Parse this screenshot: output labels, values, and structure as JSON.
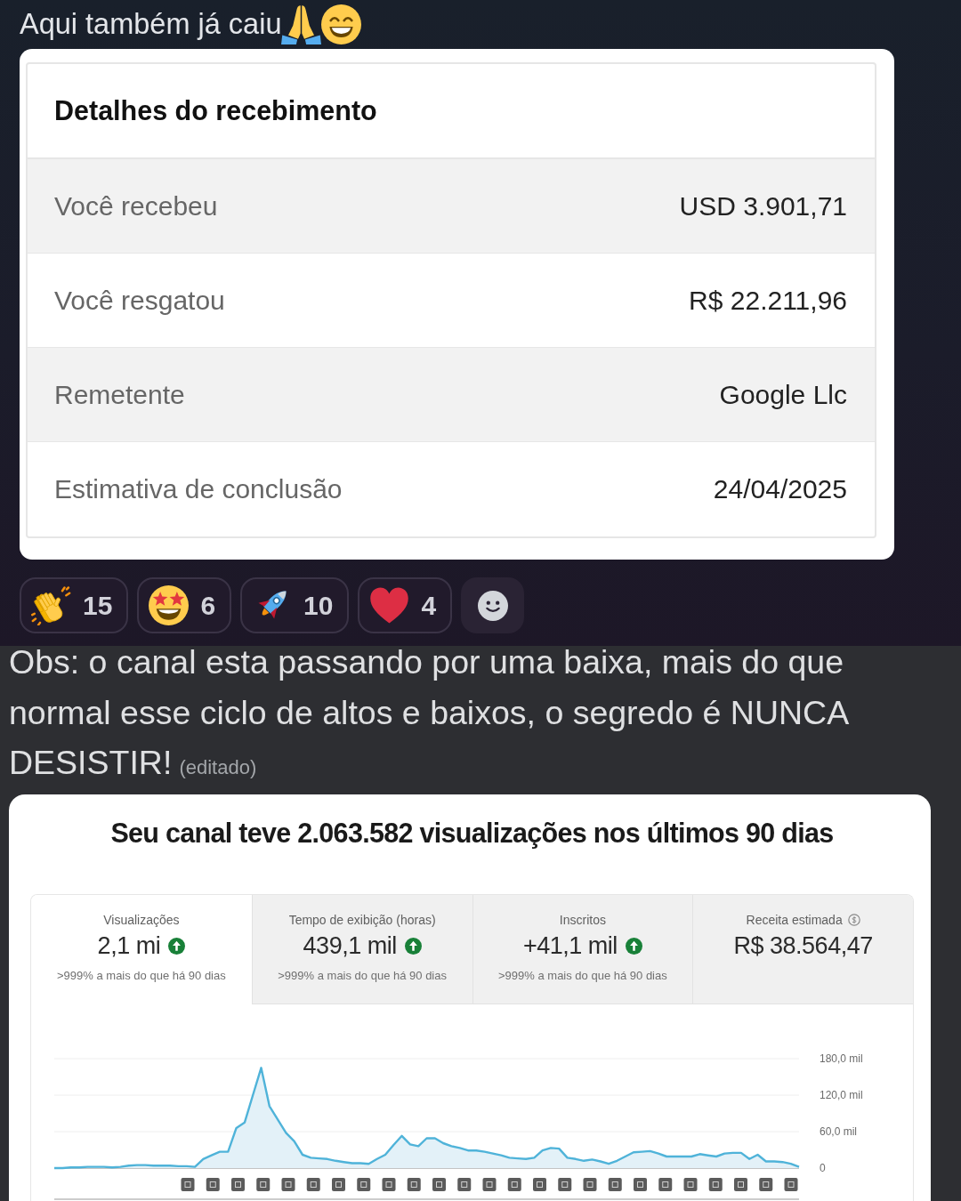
{
  "message": {
    "text": "Aqui também já caiu",
    "emojis": [
      {
        "kind": "praying-hands"
      },
      {
        "kind": "grinning-face"
      }
    ]
  },
  "receipt": {
    "title": "Detalhes do recebimento",
    "rows": [
      {
        "label": "Você recebeu",
        "value": "USD 3.901,71"
      },
      {
        "label": "Você resgatou",
        "value": "R$ 22.211,96"
      },
      {
        "label": "Remetente",
        "value": "Google Llc"
      },
      {
        "label": "Estimativa de conclusão",
        "value": "24/04/2025"
      }
    ]
  },
  "reactions": [
    {
      "kind": "clapping-hands",
      "count": "15"
    },
    {
      "kind": "star-struck",
      "count": "6"
    },
    {
      "kind": "rocket",
      "count": "10"
    },
    {
      "kind": "heart",
      "count": "4"
    }
  ],
  "note_message": {
    "text": "Obs: o canal esta passando por uma baixa, mais do que normal esse ciclo de altos e baixos, o segredo é NUNCA DESISTIR!",
    "edited_label": "(editado)"
  },
  "analytics": {
    "title": "Seu canal teve 2.063.582 visualizações nos últimos 90 dias",
    "metrics": [
      {
        "label": "Visualizações",
        "label_icon": false,
        "value": "2,1 mi",
        "increased": true,
        "note": ">999% a mais do que há 90 dias",
        "selected": true
      },
      {
        "label": "Tempo de exibição (horas)",
        "label_icon": false,
        "value": "439,1 mil",
        "increased": true,
        "note": ">999% a mais do que há 90 dias",
        "selected": false
      },
      {
        "label": "Inscritos",
        "label_icon": false,
        "value": "+41,1 mil",
        "increased": true,
        "note": ">999% a mais do que há 90 dias",
        "selected": false
      },
      {
        "label": "Receita estimada",
        "label_icon": true,
        "value": "R$ 38.564,47",
        "increased": false,
        "selected": false
      }
    ],
    "chart_data": {
      "type": "area",
      "categories": [
        null,
        null,
        null,
        null,
        null,
        null,
        null,
        null,
        null,
        null,
        null,
        null,
        null,
        null,
        null,
        null,
        null,
        null,
        null,
        null,
        null,
        null,
        null,
        null,
        null,
        null,
        null,
        null,
        null,
        null,
        null,
        null,
        null,
        null,
        null,
        null,
        null,
        null,
        null,
        null,
        null,
        null,
        null,
        null,
        null,
        null,
        null,
        null,
        null,
        null,
        null,
        null,
        null,
        null,
        null,
        null,
        null,
        null,
        null,
        null,
        null,
        null,
        null,
        null,
        null,
        null,
        null,
        null,
        null,
        null,
        null,
        null,
        null,
        null,
        null,
        null,
        null,
        null,
        null,
        null,
        null,
        null,
        null,
        null,
        null,
        null,
        null,
        null,
        null,
        null,
        null
      ],
      "values": [
        0,
        0,
        1,
        1,
        2,
        2,
        2,
        1,
        2,
        4,
        5,
        5,
        4,
        4,
        4,
        3,
        3,
        2,
        15,
        21,
        27,
        27,
        66,
        75,
        120,
        165,
        102,
        80,
        58,
        44,
        22,
        17,
        16,
        15,
        12,
        10,
        8,
        8,
        7,
        15,
        22,
        38,
        53,
        39,
        36,
        49,
        49,
        41,
        36,
        33,
        29,
        29,
        27,
        24,
        21,
        17,
        16,
        15,
        17,
        29,
        33,
        32,
        17,
        15,
        12,
        14,
        11,
        7,
        12,
        19,
        26,
        27,
        28,
        24,
        19,
        19,
        19,
        19,
        23,
        21,
        19,
        24,
        25,
        25,
        15,
        22,
        11,
        11,
        10,
        7,
        2
      ],
      "ylim": [
        0,
        180
      ],
      "yticks": [
        {
          "value": 0,
          "label": "0"
        },
        {
          "value": 60,
          "label": "60,0 mil"
        },
        {
          "value": 120,
          "label": "120,0 mil"
        },
        {
          "value": 180,
          "label": "180,0 mil"
        }
      ]
    }
  }
}
